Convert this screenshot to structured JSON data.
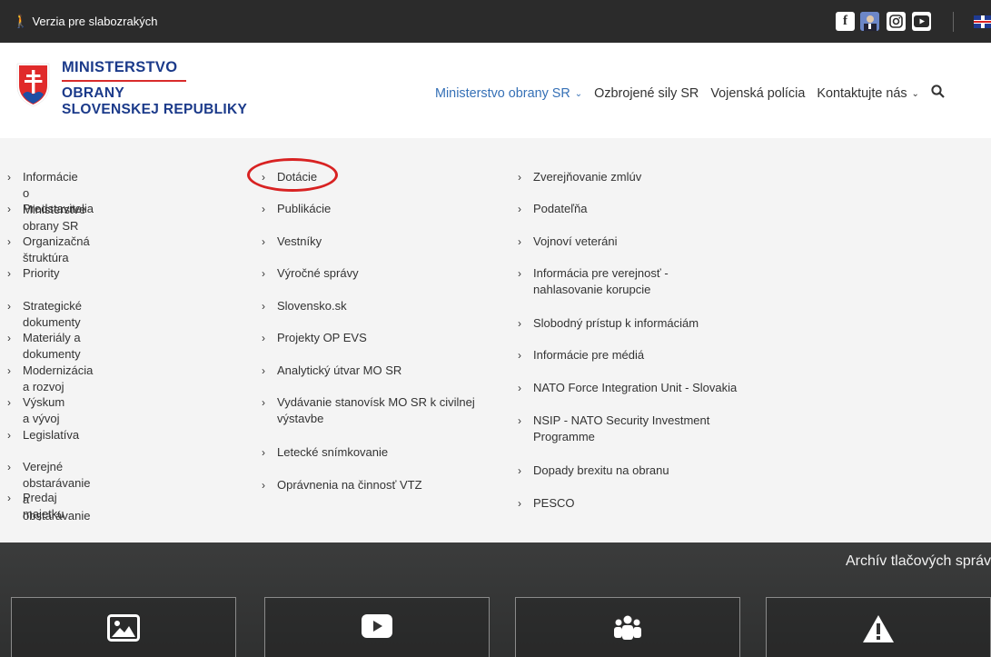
{
  "topbar": {
    "access_label": "Verzia pre slabozrakých",
    "social": [
      "facebook-icon",
      "photo-icon",
      "instagram-icon",
      "youtube-icon"
    ],
    "language": "english-flag-icon"
  },
  "logo": {
    "line1": "MINISTERSTVO",
    "line2": "OBRANY",
    "line3": "SLOVENSKEJ REPUBLIKY"
  },
  "nav": {
    "items": [
      {
        "label": "Ministerstvo obrany SR",
        "active": true,
        "dropdown": true
      },
      {
        "label": "Ozbrojené sily SR",
        "active": false,
        "dropdown": false
      },
      {
        "label": "Vojenská polícia",
        "active": false,
        "dropdown": false
      },
      {
        "label": "Kontaktujte nás",
        "active": false,
        "dropdown": true
      }
    ]
  },
  "menu": {
    "col1": [
      "Informácie o Ministerstve obrany SR",
      "Predstavitelia",
      "Organizačná štruktúra",
      "Priority",
      "Strategické dokumenty",
      "Materiály a dokumenty",
      "Modernizácia a rozvoj",
      "Výskum a vývoj",
      "Legislatíva",
      "Verejné obstarávanie a obstarávanie",
      "Predaj majetku"
    ],
    "col2": [
      "Dotácie",
      "Publikácie",
      "Vestníky",
      "Výročné správy",
      "Slovensko.sk",
      "Projekty OP EVS",
      "Analytický útvar MO SR",
      "Vydávanie stanovísk MO SR k civilnej výstavbe",
      "Letecké snímkovanie",
      "Oprávnenia na činnosť VTZ"
    ],
    "col3": [
      "Zverejňovanie zmlúv",
      "Podateľňa",
      "Vojnoví veteráni",
      "Informácia pre verejnosť - nahlasovanie korupcie",
      "Slobodný prístup k informáciám",
      "Informácie pre médiá",
      "NATO Force Integration Unit - Slovakia",
      "NSIP - NATO Security Investment Programme",
      "Dopady brexitu na obranu",
      "PESCO"
    ]
  },
  "bottom": {
    "archive_label": "Archív tlačových správ",
    "tiles": [
      "gallery-icon",
      "video-icon",
      "people-icon",
      "warning-icon"
    ]
  },
  "colors": {
    "accent": "#3570b6",
    "topbar": "#2b2b2b",
    "highlight": "#d82222"
  }
}
